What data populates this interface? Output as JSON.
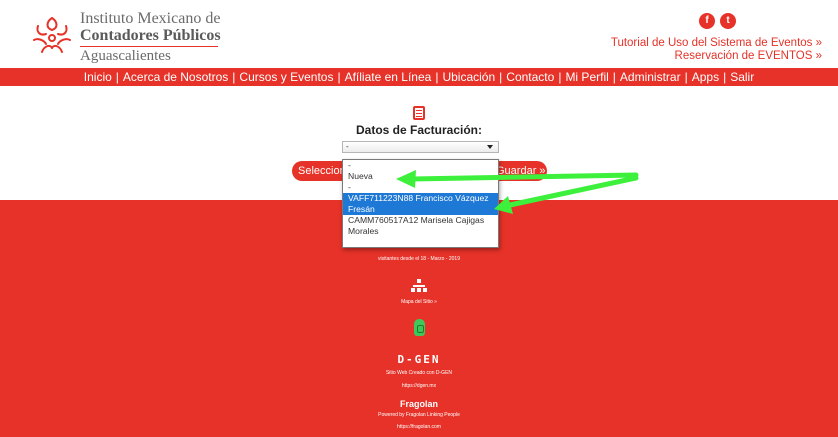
{
  "header": {
    "logo_line1": "Instituto Mexicano de",
    "logo_line2": "Contadores Públicos",
    "logo_line3": "Aguascalientes",
    "social_facebook": "f",
    "social_twitter": "t",
    "link_tutorial": "Tutorial de Uso del Sistema de Eventos »",
    "link_reservation": "Reservación de EVENTOS »"
  },
  "nav": {
    "items": [
      "Inicio",
      "Acerca de Nosotros",
      "Cursos y Eventos",
      "Afíliate en Línea",
      "Ubicación",
      "Contacto",
      "Mi Perfil",
      "Administrar",
      "Apps",
      "Salir"
    ],
    "separator": "|"
  },
  "billing": {
    "title": "Datos de Facturación:",
    "selected_value": "-",
    "select_button": "Seleccionar",
    "save_button": "Guardar »",
    "options": [
      "-",
      "Nueva",
      "-",
      "VAFF711223N88 Francisco Vázquez Fresán",
      "CAMM760517A12 Marisela Cajigas Morales"
    ],
    "highlighted_option": "VAFF711223N88 Francisco Vázquez Fresán"
  },
  "footer": {
    "visits": "visitantes desde el 18 - Marzo - 2019",
    "sitemap": "Mapa del Sitio »",
    "dgen_logo": "D-GEN",
    "dgen_caption": "Sitio Web Creado con D-GEN",
    "dgen_url": "https://dgen.mx",
    "fragolan_logo": "Fragolan",
    "fragolan_caption": "Powered by Fragolan Linking People",
    "fragolan_url": "https://fragolan.com"
  },
  "colors": {
    "brand_red": "#e63228",
    "highlight_blue": "#1e78d6",
    "annotation_green": "#3cf03c"
  }
}
